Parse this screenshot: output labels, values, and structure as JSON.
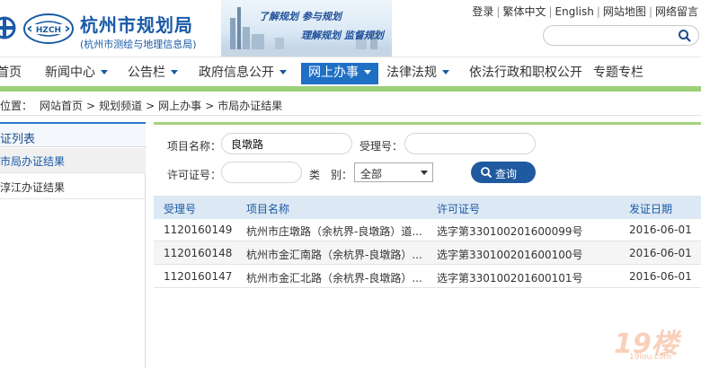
{
  "header": {
    "org_name": "杭州市规划局",
    "org_sub": "(杭州市测绘与地理信息局)",
    "badge_text": "HZCH",
    "slogan1": "了解规划 参与规划",
    "slogan2": "理解规划 监督规划",
    "top_links": [
      "登录",
      "繁体中文",
      "English",
      "网站地图",
      "网络留言"
    ]
  },
  "nav": {
    "items": [
      {
        "label": "首页",
        "caret": false
      },
      {
        "label": "新闻中心",
        "caret": true
      },
      {
        "label": "公告栏",
        "caret": true
      },
      {
        "label": "政府信息公开",
        "caret": true
      },
      {
        "label": "网上办事",
        "caret": true,
        "active": true
      },
      {
        "label": "法律法规",
        "caret": true
      },
      {
        "label": "依法行政和职权公开",
        "caret": false
      },
      {
        "label": "专题专栏",
        "caret": false
      }
    ]
  },
  "breadcrumb": {
    "prefix": "位置：",
    "items": [
      "网站首页",
      "规划频道",
      "网上办事",
      "市局办证结果"
    ]
  },
  "sidebar": {
    "title": "证列表",
    "items": [
      "市局办证结果",
      "淳江办证结果"
    ]
  },
  "form": {
    "project_label": "项目名称：",
    "project_value": "良墩路",
    "accept_label": "受理号：",
    "accept_value": "",
    "permit_label": "许可证号：",
    "permit_value": "",
    "type_label": "类　别：",
    "type_value": "全部",
    "query_label": "查询"
  },
  "table": {
    "headers": [
      "受理号",
      "项目名称",
      "许可证号",
      "发证日期"
    ],
    "rows": [
      [
        "1120160149",
        "杭州市庄墩路（余杭界-良墩路）道...",
        "选字第330100201600099号",
        "2016-06-01"
      ],
      [
        "1120160148",
        "杭州市金汇南路（余杭界-良墩路）...",
        "选字第330100201600100号",
        "2016-06-01"
      ],
      [
        "1120160147",
        "杭州市金汇北路（余杭界-良墩路）...",
        "选字第330100201600101号",
        "2016-06-01"
      ]
    ]
  },
  "watermark": {
    "main": "19楼",
    "sub": "19lou.com"
  },
  "colors": {
    "brand_blue": "#1a5aa6",
    "nav_active": "#1f6fc5",
    "green_bar": "#9ccf7a",
    "query_button": "#1f5aa0"
  }
}
